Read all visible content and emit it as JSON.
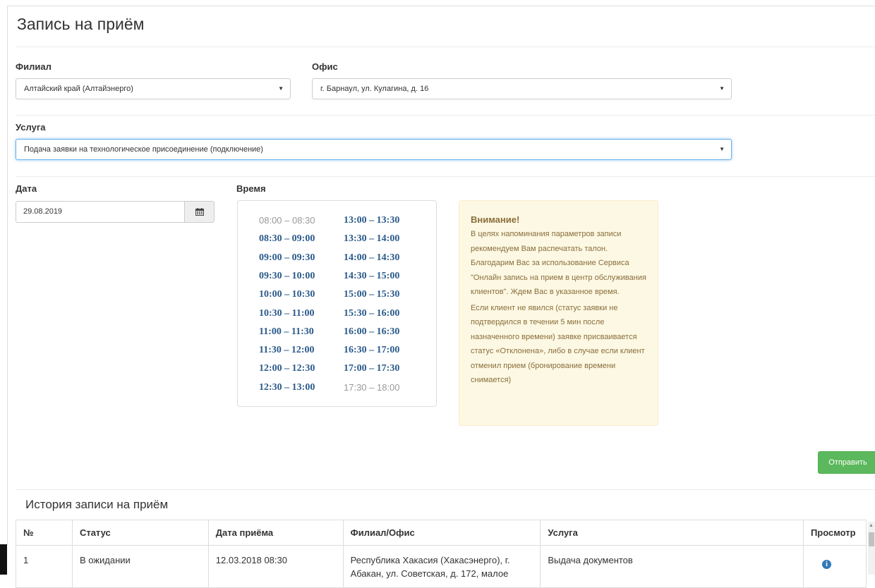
{
  "page_title": "Запись на приём",
  "filial": {
    "label": "Филиал",
    "value": "Алтайский край (Алтайэнерго)"
  },
  "office": {
    "label": "Офис",
    "value": "г. Барнаул, ул. Кулагина, д. 16"
  },
  "service": {
    "label": "Услуга",
    "value": "Подача заявки на технологическое присоединение (подключение)"
  },
  "date": {
    "label": "Дата",
    "value": "29.08.2019"
  },
  "time": {
    "label": "Время",
    "left_column": [
      {
        "text": "08:00 – 08:30",
        "available": false
      },
      {
        "text": "08:30 – 09:00",
        "available": true
      },
      {
        "text": "09:00 – 09:30",
        "available": true
      },
      {
        "text": "09:30 – 10:00",
        "available": true
      },
      {
        "text": "10:00 – 10:30",
        "available": true
      },
      {
        "text": "10:30 – 11:00",
        "available": true
      },
      {
        "text": "11:00 – 11:30",
        "available": true
      },
      {
        "text": "11:30 – 12:00",
        "available": true
      },
      {
        "text": "12:00 – 12:30",
        "available": true
      },
      {
        "text": "12:30 – 13:00",
        "available": true
      }
    ],
    "right_column": [
      {
        "text": "13:00 – 13:30",
        "available": true
      },
      {
        "text": "13:30 – 14:00",
        "available": true
      },
      {
        "text": "14:00 – 14:30",
        "available": true
      },
      {
        "text": "14:30 – 15:00",
        "available": true
      },
      {
        "text": "15:00 – 15:30",
        "available": true
      },
      {
        "text": "15:30 – 16:00",
        "available": true
      },
      {
        "text": "16:00 – 16:30",
        "available": true
      },
      {
        "text": "16:30 – 17:00",
        "available": true
      },
      {
        "text": "17:00 – 17:30",
        "available": true
      },
      {
        "text": "17:30 – 18:00",
        "available": false
      }
    ]
  },
  "notice": {
    "title": "Внимание!",
    "p1": "В целях напоминания параметров записи рекомендуем Вам распечатать талон. Благодарим Вас за использование Сервиса \"Онлайн запись на прием в центр обслуживания клиентов\". Ждем Вас в указанное время.",
    "p2": "Если клиент не явился (статус заявки не подтвердился в течении 5 мин после назначенного времени) заявке присваивается статус «Отклонена», либо в случае если клиент отменил прием (бронирование времени снимается)"
  },
  "submit_label": "Отправить",
  "history": {
    "title": "История записи на приём",
    "columns": [
      "№",
      "Статус",
      "Дата приёма",
      "Филиал/Офис",
      "Услуга",
      "Просмотр"
    ],
    "rows": [
      {
        "num": "1",
        "status": "В ожидании",
        "date": "12.03.2018 08:30",
        "office": "Республика Хакасия (Хакасэнерго), г. Абакан, ул. Советская, д. 172, малое",
        "service": "Выдача документов"
      }
    ]
  },
  "colors": {
    "accent_blue": "#2a5a8a",
    "success_green": "#5cb85c",
    "notice_bg": "#fcf8e3",
    "notice_text": "#8a6d3b",
    "focus_border": "#66afe9"
  },
  "icons": {
    "select_caret": "▼",
    "calendar": "calendar-icon",
    "view": "info-icon"
  }
}
